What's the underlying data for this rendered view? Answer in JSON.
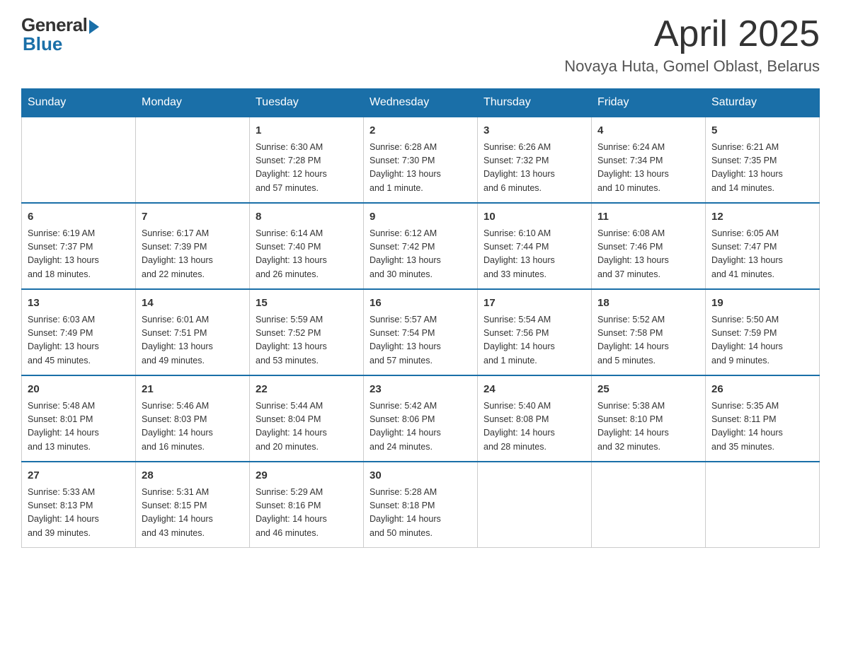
{
  "header": {
    "logo_general": "General",
    "logo_blue": "Blue",
    "title": "April 2025",
    "location": "Novaya Huta, Gomel Oblast, Belarus"
  },
  "calendar": {
    "days_of_week": [
      "Sunday",
      "Monday",
      "Tuesday",
      "Wednesday",
      "Thursday",
      "Friday",
      "Saturday"
    ],
    "weeks": [
      [
        {
          "day": "",
          "info": ""
        },
        {
          "day": "",
          "info": ""
        },
        {
          "day": "1",
          "info": "Sunrise: 6:30 AM\nSunset: 7:28 PM\nDaylight: 12 hours\nand 57 minutes."
        },
        {
          "day": "2",
          "info": "Sunrise: 6:28 AM\nSunset: 7:30 PM\nDaylight: 13 hours\nand 1 minute."
        },
        {
          "day": "3",
          "info": "Sunrise: 6:26 AM\nSunset: 7:32 PM\nDaylight: 13 hours\nand 6 minutes."
        },
        {
          "day": "4",
          "info": "Sunrise: 6:24 AM\nSunset: 7:34 PM\nDaylight: 13 hours\nand 10 minutes."
        },
        {
          "day": "5",
          "info": "Sunrise: 6:21 AM\nSunset: 7:35 PM\nDaylight: 13 hours\nand 14 minutes."
        }
      ],
      [
        {
          "day": "6",
          "info": "Sunrise: 6:19 AM\nSunset: 7:37 PM\nDaylight: 13 hours\nand 18 minutes."
        },
        {
          "day": "7",
          "info": "Sunrise: 6:17 AM\nSunset: 7:39 PM\nDaylight: 13 hours\nand 22 minutes."
        },
        {
          "day": "8",
          "info": "Sunrise: 6:14 AM\nSunset: 7:40 PM\nDaylight: 13 hours\nand 26 minutes."
        },
        {
          "day": "9",
          "info": "Sunrise: 6:12 AM\nSunset: 7:42 PM\nDaylight: 13 hours\nand 30 minutes."
        },
        {
          "day": "10",
          "info": "Sunrise: 6:10 AM\nSunset: 7:44 PM\nDaylight: 13 hours\nand 33 minutes."
        },
        {
          "day": "11",
          "info": "Sunrise: 6:08 AM\nSunset: 7:46 PM\nDaylight: 13 hours\nand 37 minutes."
        },
        {
          "day": "12",
          "info": "Sunrise: 6:05 AM\nSunset: 7:47 PM\nDaylight: 13 hours\nand 41 minutes."
        }
      ],
      [
        {
          "day": "13",
          "info": "Sunrise: 6:03 AM\nSunset: 7:49 PM\nDaylight: 13 hours\nand 45 minutes."
        },
        {
          "day": "14",
          "info": "Sunrise: 6:01 AM\nSunset: 7:51 PM\nDaylight: 13 hours\nand 49 minutes."
        },
        {
          "day": "15",
          "info": "Sunrise: 5:59 AM\nSunset: 7:52 PM\nDaylight: 13 hours\nand 53 minutes."
        },
        {
          "day": "16",
          "info": "Sunrise: 5:57 AM\nSunset: 7:54 PM\nDaylight: 13 hours\nand 57 minutes."
        },
        {
          "day": "17",
          "info": "Sunrise: 5:54 AM\nSunset: 7:56 PM\nDaylight: 14 hours\nand 1 minute."
        },
        {
          "day": "18",
          "info": "Sunrise: 5:52 AM\nSunset: 7:58 PM\nDaylight: 14 hours\nand 5 minutes."
        },
        {
          "day": "19",
          "info": "Sunrise: 5:50 AM\nSunset: 7:59 PM\nDaylight: 14 hours\nand 9 minutes."
        }
      ],
      [
        {
          "day": "20",
          "info": "Sunrise: 5:48 AM\nSunset: 8:01 PM\nDaylight: 14 hours\nand 13 minutes."
        },
        {
          "day": "21",
          "info": "Sunrise: 5:46 AM\nSunset: 8:03 PM\nDaylight: 14 hours\nand 16 minutes."
        },
        {
          "day": "22",
          "info": "Sunrise: 5:44 AM\nSunset: 8:04 PM\nDaylight: 14 hours\nand 20 minutes."
        },
        {
          "day": "23",
          "info": "Sunrise: 5:42 AM\nSunset: 8:06 PM\nDaylight: 14 hours\nand 24 minutes."
        },
        {
          "day": "24",
          "info": "Sunrise: 5:40 AM\nSunset: 8:08 PM\nDaylight: 14 hours\nand 28 minutes."
        },
        {
          "day": "25",
          "info": "Sunrise: 5:38 AM\nSunset: 8:10 PM\nDaylight: 14 hours\nand 32 minutes."
        },
        {
          "day": "26",
          "info": "Sunrise: 5:35 AM\nSunset: 8:11 PM\nDaylight: 14 hours\nand 35 minutes."
        }
      ],
      [
        {
          "day": "27",
          "info": "Sunrise: 5:33 AM\nSunset: 8:13 PM\nDaylight: 14 hours\nand 39 minutes."
        },
        {
          "day": "28",
          "info": "Sunrise: 5:31 AM\nSunset: 8:15 PM\nDaylight: 14 hours\nand 43 minutes."
        },
        {
          "day": "29",
          "info": "Sunrise: 5:29 AM\nSunset: 8:16 PM\nDaylight: 14 hours\nand 46 minutes."
        },
        {
          "day": "30",
          "info": "Sunrise: 5:28 AM\nSunset: 8:18 PM\nDaylight: 14 hours\nand 50 minutes."
        },
        {
          "day": "",
          "info": ""
        },
        {
          "day": "",
          "info": ""
        },
        {
          "day": "",
          "info": ""
        }
      ]
    ]
  }
}
